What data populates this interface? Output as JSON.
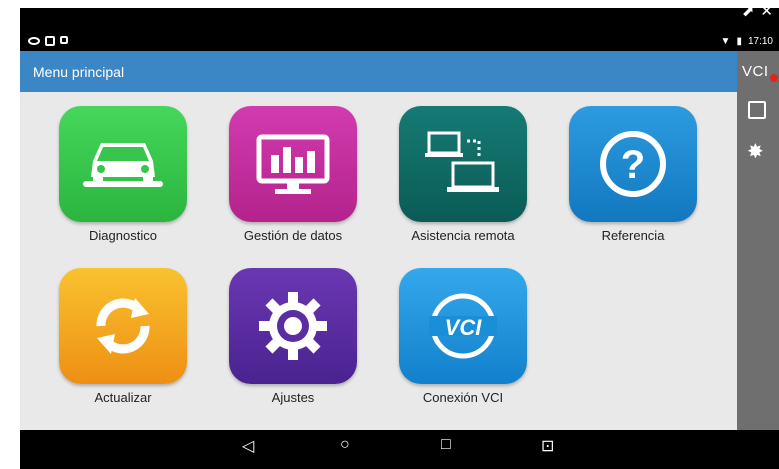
{
  "header": {
    "title": "Menu principal"
  },
  "status": {
    "time": "17:10"
  },
  "sidebar": {
    "vci_label": "VCI"
  },
  "tiles": [
    {
      "label": "Diagnostico",
      "icon": "car-wrench-icon",
      "color": "#34c84a"
    },
    {
      "label": "Gestión de datos",
      "icon": "monitor-chart-icon",
      "color": "#c52a9e"
    },
    {
      "label": "Asistencia remota",
      "icon": "laptops-icon",
      "color": "#0f6b66"
    },
    {
      "label": "Referencia",
      "icon": "question-icon",
      "color": "#1b87cf"
    },
    {
      "label": "Actualizar",
      "icon": "refresh-icon",
      "color": "#f1a41c"
    },
    {
      "label": "Ajustes",
      "icon": "gear-icon",
      "color": "#5d2fa1"
    },
    {
      "label": "Conexión VCI",
      "icon": "vci-logo-icon",
      "color": "#1a8fd8"
    }
  ],
  "nav": {
    "back": "◁",
    "home": "○",
    "recents": "□",
    "screenshot": "⊡"
  }
}
